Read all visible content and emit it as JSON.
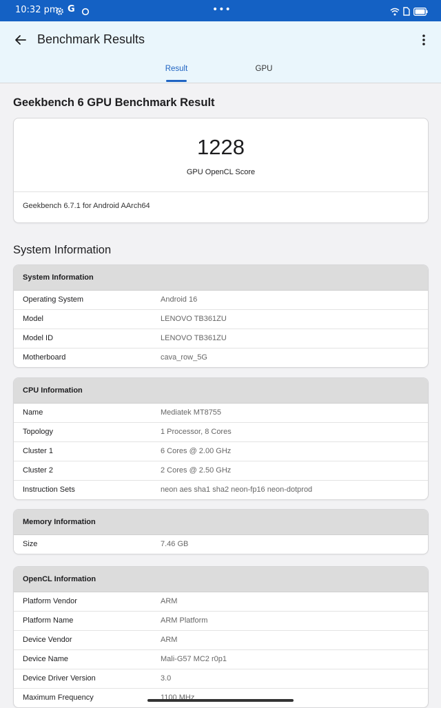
{
  "status_bar": {
    "time": "10:32 pm",
    "icons": [
      "settings-gear-icon",
      "google-g-icon",
      "sync-circle-icon"
    ],
    "more": "•••",
    "right_icons": [
      "wifi-icon",
      "sim-icon",
      "battery-icon"
    ],
    "color": "#1461c4"
  },
  "app_bar": {
    "title": "Benchmark Results",
    "back_icon": "arrow-left-icon",
    "menu_icon": "more-vert-icon",
    "background": "#eaf6fc",
    "tabs": [
      {
        "label": "Result",
        "selected": true
      },
      {
        "label": "GPU",
        "selected": false
      }
    ],
    "accent": "#1f63c2"
  },
  "result": {
    "heading": "Geekbench 6 GPU Benchmark Result",
    "score": "1228",
    "score_label": "GPU OpenCL Score",
    "version": "Geekbench 6.7.1 for Android AArch64"
  },
  "system_heading": "System Information",
  "sections": [
    {
      "title": "System Information",
      "rows": [
        {
          "k": "Operating System",
          "v": "Android 16"
        },
        {
          "k": "Model",
          "v": "LENOVO TB361ZU"
        },
        {
          "k": "Model ID",
          "v": "LENOVO TB361ZU"
        },
        {
          "k": "Motherboard",
          "v": "cava_row_5G"
        }
      ]
    },
    {
      "title": "CPU Information",
      "rows": [
        {
          "k": "Name",
          "v": "Mediatek MT8755"
        },
        {
          "k": "Topology",
          "v": "1 Processor, 8 Cores"
        },
        {
          "k": "Cluster 1",
          "v": "6 Cores @ 2.00 GHz"
        },
        {
          "k": "Cluster 2",
          "v": "2 Cores @ 2.50 GHz"
        },
        {
          "k": "Instruction Sets",
          "v": "neon aes sha1 sha2 neon-fp16 neon-dotprod"
        }
      ]
    },
    {
      "title": "Memory Information",
      "rows": [
        {
          "k": "Size",
          "v": "7.46 GB"
        }
      ]
    },
    {
      "title": "OpenCL Information",
      "rows": [
        {
          "k": "Platform Vendor",
          "v": "ARM"
        },
        {
          "k": "Platform Name",
          "v": "ARM Platform"
        },
        {
          "k": "Device Vendor",
          "v": "ARM"
        },
        {
          "k": "Device Name",
          "v": "Mali-G57 MC2 r0p1"
        },
        {
          "k": "Device Driver Version",
          "v": "3.0"
        },
        {
          "k": "Maximum Frequency",
          "v": "1100 MHz"
        }
      ]
    }
  ]
}
